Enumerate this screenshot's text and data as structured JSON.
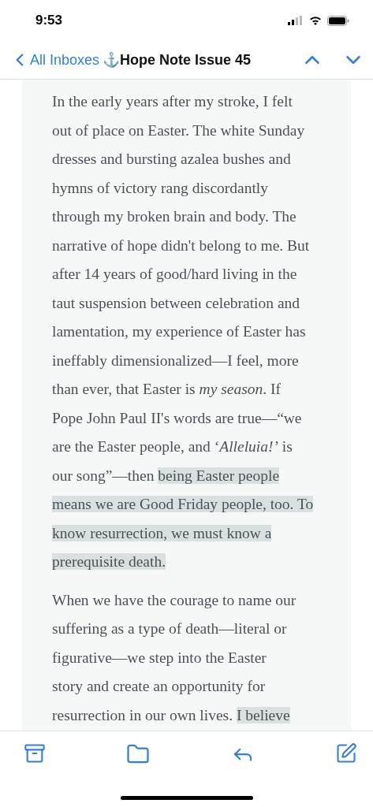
{
  "status_bar": {
    "time": "9:53"
  },
  "nav": {
    "back_label": "All Inboxes",
    "title": "⚓Hope Note Issue 45"
  },
  "paragraphs": [
    {
      "lines": [
        [
          {
            "text": "In the early years after my stroke, I felt",
            "highlighted": false
          }
        ],
        [
          {
            "text": "out of place on Easter. The white Sunday",
            "highlighted": false
          }
        ],
        [
          {
            "text": "dresses and bursting azalea bushes and",
            "highlighted": false
          }
        ],
        [
          {
            "text": "hymns of victory rang discordantly",
            "highlighted": false
          }
        ],
        [
          {
            "text": "through my broken brain and body. The",
            "highlighted": false
          }
        ],
        [
          {
            "text": "narrative of hope didn't belong to me. But",
            "highlighted": false
          }
        ],
        [
          {
            "text": "after 14 years of good/hard living in the",
            "highlighted": false
          }
        ],
        [
          {
            "text": "taut suspension between celebration and",
            "highlighted": false
          }
        ],
        [
          {
            "text": "lamentation, my experience of Easter has",
            "highlighted": false
          }
        ],
        [
          {
            "text": "ineffably dimensionalized—I feel, more",
            "highlighted": false
          }
        ],
        [
          {
            "text": "than ever, that Easter is *my season*. If",
            "highlighted": false
          }
        ],
        [
          {
            "text": "Pope John Paul II's words are true—“we",
            "highlighted": false
          }
        ],
        [
          {
            "text": "are the Easter people, and ‘*Alleluia!’* is",
            "highlighted": false
          }
        ],
        [
          {
            "text": "our song”—then ",
            "highlighted": false
          },
          {
            "text": "being Easter people",
            "highlighted": true
          }
        ],
        [
          {
            "text": "means we are Good Friday people, too. To",
            "highlighted": true
          }
        ],
        [
          {
            "text": "know resurrection, we must know a",
            "highlighted": true
          }
        ],
        [
          {
            "text": "prerequisite death.",
            "highlighted": true
          }
        ]
      ]
    },
    {
      "lines": [
        [
          {
            "text": "When we have the courage to name our",
            "highlighted": false
          }
        ],
        [
          {
            "text": "suffering as a type of death—literal or",
            "highlighted": false
          }
        ],
        [
          {
            "text": "figurative—we step into the Easter",
            "highlighted": false
          }
        ],
        [
          {
            "text": "story and create an opportunity for",
            "highlighted": false
          }
        ],
        [
          {
            "text": "resurrection in our own lives. ",
            "highlighted": false
          },
          {
            "text": "I believe",
            "highlighted": true
          }
        ]
      ]
    }
  ]
}
